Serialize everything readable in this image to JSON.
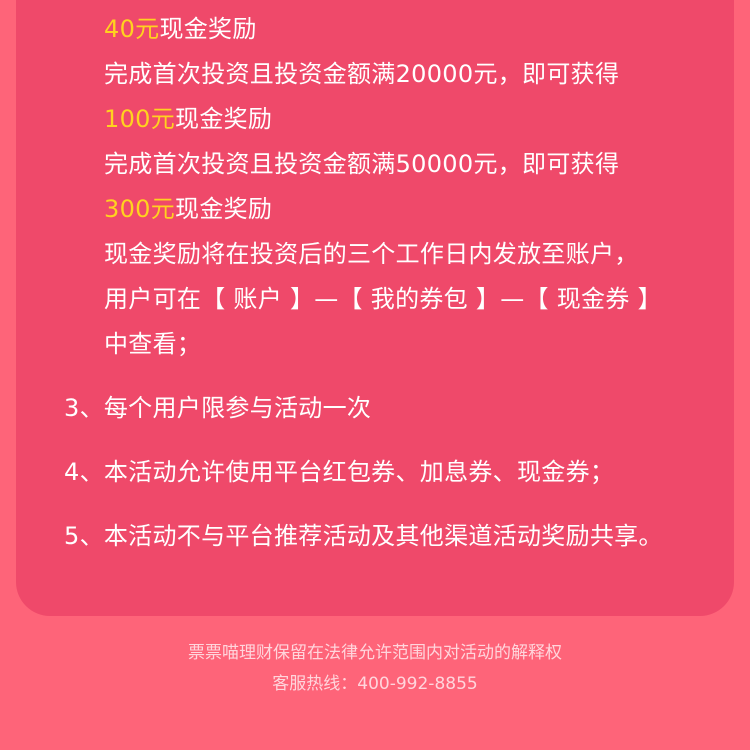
{
  "colors": {
    "background": "#fe6479",
    "card": "#ef496a",
    "highlight": "#ffd21f",
    "text": "#ffffff",
    "footer_text": "#ffd5dc"
  },
  "reward_lines": [
    {
      "amount": "40元",
      "suffix": "现金奖励"
    },
    {
      "text": "完成首次投资且投资金额满20000元，即可获得"
    },
    {
      "amount": "100元",
      "suffix": "现金奖励"
    },
    {
      "text": "完成首次投资且投资金额满50000元，即可获得"
    },
    {
      "amount": "300元",
      "suffix": "现金奖励"
    },
    {
      "text": "现金奖励将在投资后的三个工作日内发放至账户，"
    },
    {
      "text": "用户可在【 账户 】—【 我的券包 】—【 现金券 】"
    },
    {
      "text": "中查看；"
    }
  ],
  "rules": [
    {
      "number": "3、",
      "text": "每个用户限参与活动一次"
    },
    {
      "number": "4、",
      "text": "本活动允许使用平台红包券、加息券、现金券；"
    },
    {
      "number": "5、",
      "text": "本活动不与平台推荐活动及其他渠道活动奖励共享。"
    }
  ],
  "footer": {
    "rights": "票票喵理财保留在法律允许范围内对活动的解释权",
    "hotline": "客服热线：400-992-8855"
  }
}
